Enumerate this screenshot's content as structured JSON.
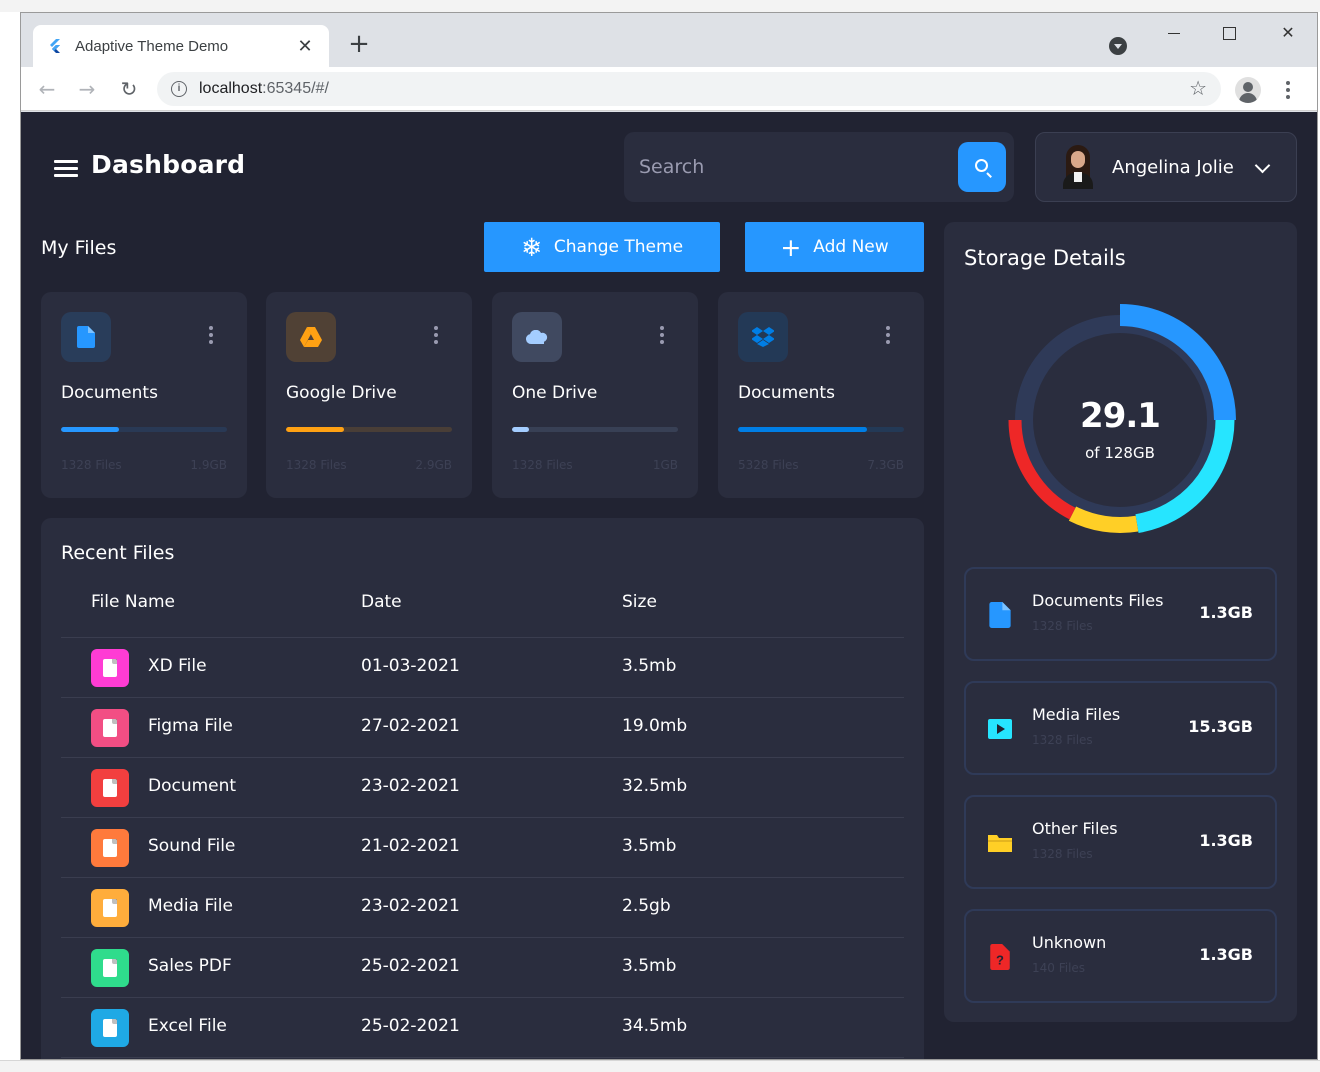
{
  "browser": {
    "tab_title": "Adaptive Theme Demo",
    "new_tab_label": "+",
    "url_host": "localhost",
    "url_path": ":65345/#/"
  },
  "header": {
    "title": "Dashboard",
    "search_placeholder": "Search",
    "user_name": "Angelina Jolie"
  },
  "my_files": {
    "title": "My Files",
    "change_theme_label": "Change Theme",
    "add_new_label": "Add New",
    "cards": [
      {
        "title": "Documents",
        "count": "1328 Files",
        "size": "1.9GB",
        "progress": 0.35,
        "color": "#2697ff",
        "icon": "document-icon"
      },
      {
        "title": "Google Drive",
        "count": "1328 Files",
        "size": "2.9GB",
        "progress": 0.35,
        "color": "#ffa113",
        "icon": "google-drive-icon"
      },
      {
        "title": "One Drive",
        "count": "1328 Files",
        "size": "1GB",
        "progress": 0.1,
        "color": "#a4cdff",
        "icon": "onedrive-icon"
      },
      {
        "title": "Documents",
        "count": "5328 Files",
        "size": "7.3GB",
        "progress": 0.78,
        "color": "#007ee5",
        "icon": "dropbox-icon"
      }
    ]
  },
  "recent_files": {
    "title": "Recent Files",
    "headers": {
      "name": "File Name",
      "date": "Date",
      "size": "Size"
    },
    "rows": [
      {
        "name": "XD File",
        "date": "01-03-2021",
        "size": "3.5mb",
        "color": "#ff3cd4",
        "icon": "xd-file-icon"
      },
      {
        "name": "Figma File",
        "date": "27-02-2021",
        "size": "19.0mb",
        "color": "#f24e84",
        "icon": "figma-file-icon"
      },
      {
        "name": "Document",
        "date": "23-02-2021",
        "size": "32.5mb",
        "color": "#f23f3f",
        "icon": "document-file-icon"
      },
      {
        "name": "Sound File",
        "date": "21-02-2021",
        "size": "3.5mb",
        "color": "#ff7a3c",
        "icon": "sound-file-icon"
      },
      {
        "name": "Media File",
        "date": "23-02-2021",
        "size": "2.5gb",
        "color": "#ffad3c",
        "icon": "media-file-icon"
      },
      {
        "name": "Sales PDF",
        "date": "25-02-2021",
        "size": "3.5mb",
        "color": "#2fdc8c",
        "icon": "pdf-file-icon"
      },
      {
        "name": "Excel File",
        "date": "25-02-2021",
        "size": "34.5mb",
        "color": "#1fa9e5",
        "icon": "excel-file-icon"
      }
    ]
  },
  "storage": {
    "title": "Storage Details",
    "used": "29.1",
    "total": "of 128GB",
    "items": [
      {
        "name": "Documents Files",
        "count": "1328 Files",
        "size": "1.3GB",
        "color": "#2697ff",
        "icon": "document-icon"
      },
      {
        "name": "Media Files",
        "count": "1328 Files",
        "size": "15.3GB",
        "color": "#26e5ff",
        "icon": "media-icon"
      },
      {
        "name": "Other Files",
        "count": "1328 Files",
        "size": "1.3GB",
        "color": "#ffcf26",
        "icon": "folder-icon"
      },
      {
        "name": "Unknown",
        "count": "140 Files",
        "size": "1.3GB",
        "color": "#ee2727",
        "icon": "unknown-file-icon"
      }
    ]
  }
}
